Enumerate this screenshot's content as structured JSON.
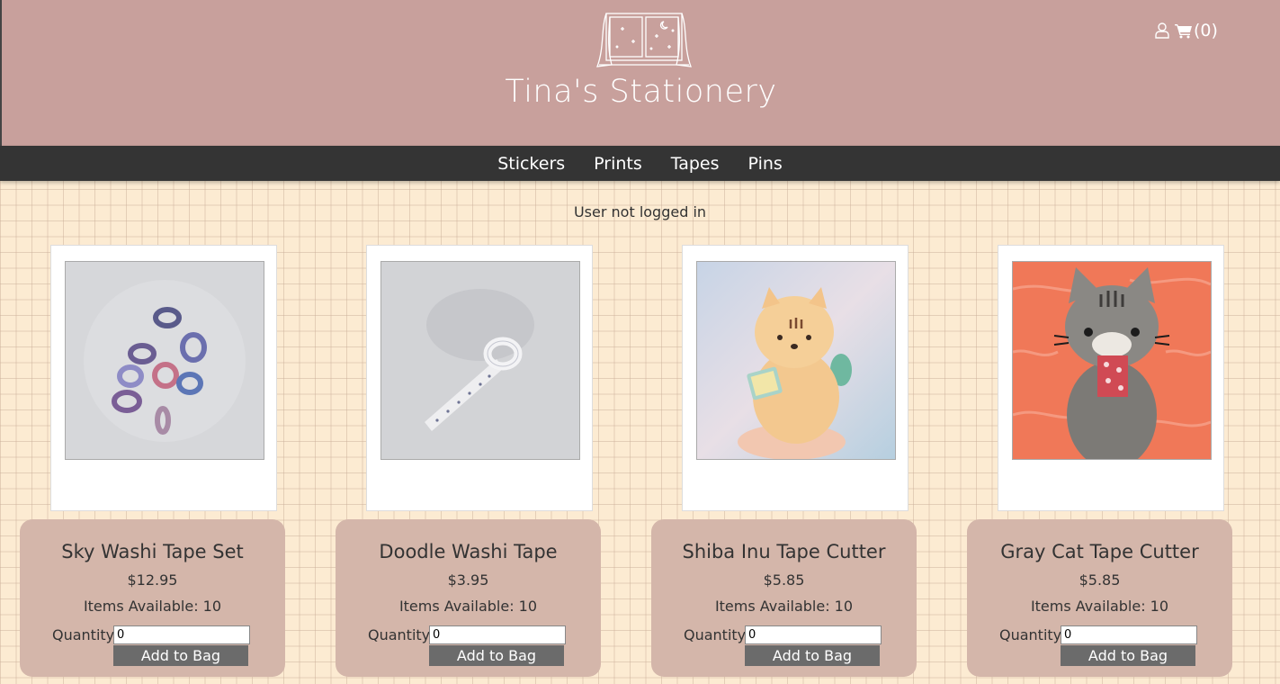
{
  "header": {
    "site_title": "Tina's Stationery",
    "logo_icon": "window-night-sky-logo",
    "user_icon": "user-icon",
    "cart_icon": "shopping-cart-icon",
    "cart_count": "(0)"
  },
  "nav": {
    "items": [
      "Stickers",
      "Prints",
      "Tapes",
      "Pins"
    ]
  },
  "status": {
    "login": "User not logged in"
  },
  "products": [
    {
      "name": "Sky Washi Tape Set",
      "price": "$12.95",
      "availability": "Items Available: 10",
      "quantity_label": "Quantity",
      "quantity_value": "0",
      "button": "Add to Bag"
    },
    {
      "name": "Doodle Washi Tape",
      "price": "$3.95",
      "availability": "Items Available: 10",
      "quantity_label": "Quantity",
      "quantity_value": "0",
      "button": "Add to Bag"
    },
    {
      "name": "Shiba Inu Tape Cutter",
      "price": "$5.85",
      "availability": "Items Available: 10",
      "quantity_label": "Quantity",
      "quantity_value": "0",
      "button": "Add to Bag"
    },
    {
      "name": "Gray Cat Tape Cutter",
      "price": "$5.85",
      "availability": "Items Available: 10",
      "quantity_label": "Quantity",
      "quantity_value": "0",
      "button": "Add to Bag"
    }
  ],
  "colors": {
    "header_bg": "#c8a09c",
    "nav_bg": "#343434",
    "card_info_bg": "#d4b6aa",
    "button_bg": "#6b6b6b",
    "page_bg": "#fcebd2"
  }
}
